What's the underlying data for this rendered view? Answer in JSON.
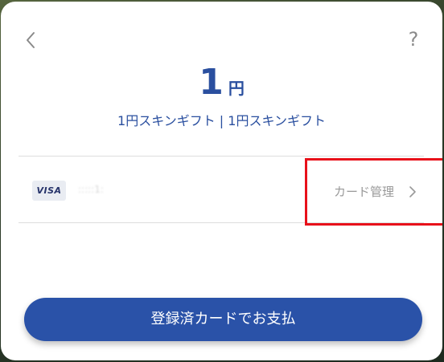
{
  "header": {
    "back_icon": "chevron-left-icon",
    "help_label": "?"
  },
  "price": {
    "amount": "1",
    "unit": "円"
  },
  "product": {
    "name": "1円スキンギフト | 1円スキンギフト"
  },
  "payment_method": {
    "brand": "VISA",
    "card_number_masked": ":::::1:",
    "manage_label": "カード管理",
    "manage_icon": "chevron-right-icon"
  },
  "actions": {
    "pay_label": "登録済カードでお支払"
  },
  "colors": {
    "accent": "#2a52a8",
    "highlight": "#e8101a"
  }
}
